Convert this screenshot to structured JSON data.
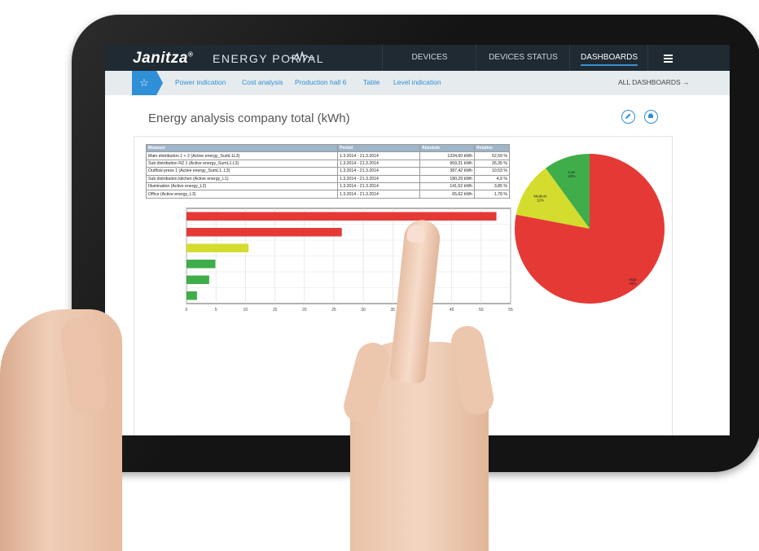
{
  "app": {
    "brand": "Janitza",
    "brand_mark": "®",
    "product": "ENERGY PORTAL",
    "accent_color": "#2f8fd7",
    "header_color": "#1f2a33"
  },
  "nav": {
    "devices": "DEVICES",
    "devices_status": "DEVICES STATUS",
    "dashboards": "DASHBOARDS",
    "menu_icon": "hamburger-icon"
  },
  "subnav": {
    "home_icon": "star-icon",
    "items": [
      "Power indication",
      "Cost analysis",
      "Production hall 6",
      "Table",
      "Level indication"
    ],
    "all_dashboards": "ALL DASHBOARDS →"
  },
  "page": {
    "title": "Energy analysis company total (kWh)",
    "edit_icon": "pencil-icon",
    "print_icon": "printer-icon"
  },
  "table": {
    "headers": [
      "Measure",
      "Period",
      "Absolute",
      "Relative"
    ],
    "rows": [
      [
        "Main distribution 1 + 2 (Active energy_SumL1L3)",
        "1.3.2014 - 21.3.2014",
        "1334,60 kWh",
        "52,59 %"
      ],
      [
        "Sub distribution RZ 1 (Active energy_SumL1.L3)",
        "1.3.2014 - 21.3.2014",
        "969,31 kWh",
        "26,35 %"
      ],
      [
        "Outflow press 1 (Active energy_SumL1..L3)",
        "1.3.2014 - 21.3.2014",
        "387,42 kWh",
        "10,53 %"
      ],
      [
        "Sub distribution kitchen (Active energy_L1)",
        "1.3.2014 - 21.3.2014",
        "180,29 kWh",
        "4,9 %"
      ],
      [
        "Illumination (Active energy_L2)",
        "1.3.2014 - 21.3.2014",
        "141,52 kWh",
        "3,85 %"
      ],
      [
        "Office (Active energy_L3)",
        "1.3.2014 - 21.3.2014",
        "65,62 kWh",
        "1,78 %"
      ]
    ]
  },
  "chart_data": [
    {
      "type": "bar",
      "orientation": "horizontal",
      "values": [
        52.59,
        26.35,
        10.53,
        4.9,
        3.85,
        1.78
      ],
      "colors": [
        "#e53935",
        "#e53935",
        "#d4dd2e",
        "#3fae4a",
        "#3fae4a",
        "#3fae4a"
      ],
      "xlim": [
        0,
        55
      ],
      "xticks": [
        "0",
        "5",
        "10",
        "15",
        "20",
        "25",
        "30",
        "35",
        "40",
        "45",
        "50",
        "55"
      ],
      "grid": true
    },
    {
      "type": "pie",
      "slices": [
        {
          "label": "Low",
          "pct_label": "10%",
          "value": 10,
          "color": "#3fae4a"
        },
        {
          "label": "Medium",
          "pct_label": "12%",
          "value": 12,
          "color": "#d4dd2e"
        },
        {
          "label": "High",
          "pct_label": "78%",
          "value": 78,
          "color": "#e53935"
        }
      ]
    }
  ]
}
